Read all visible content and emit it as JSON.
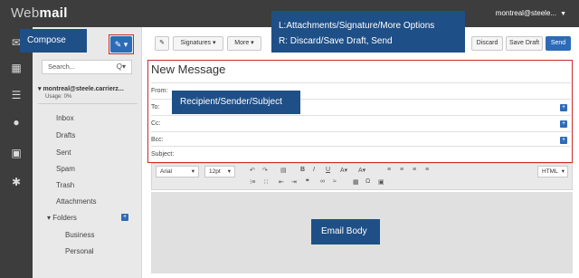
{
  "app": {
    "logo_web": "Web",
    "logo_mail": "mail",
    "account_menu": "montreal@steele...",
    "account_caret": "▼"
  },
  "sidebar": {
    "search_placeholder": "Search...",
    "account_name": "▾ montreal@steele.carrierz...",
    "usage": "Usage: 0%",
    "folders": [
      "Inbox",
      "Drafts",
      "Sent",
      "Spam",
      "Trash",
      "Attachments"
    ],
    "folders_group": "▾ Folders",
    "subfolders": [
      "Business",
      "Personal"
    ]
  },
  "toolbar": {
    "signatures": "Signatures ▾",
    "more": "More ▾",
    "discard": "Discard",
    "save_draft": "Save Draft",
    "send": "Send"
  },
  "message": {
    "title": "New Message",
    "from_label": "From:",
    "to_label": "To:",
    "cc_label": "Cc:",
    "bcc_label": "Bcc:",
    "subject_label": "Subject:"
  },
  "editor": {
    "font": "Arial",
    "size": "12pt",
    "format": "HTML"
  },
  "annotations": {
    "compose": "Compose",
    "toolbar_line1": "L:Attachments/Signature/More Options",
    "toolbar_line2": "R: Discard/Save Draft, Send",
    "recipients": "Recipient/Sender/Subject",
    "body": "Email Body"
  }
}
